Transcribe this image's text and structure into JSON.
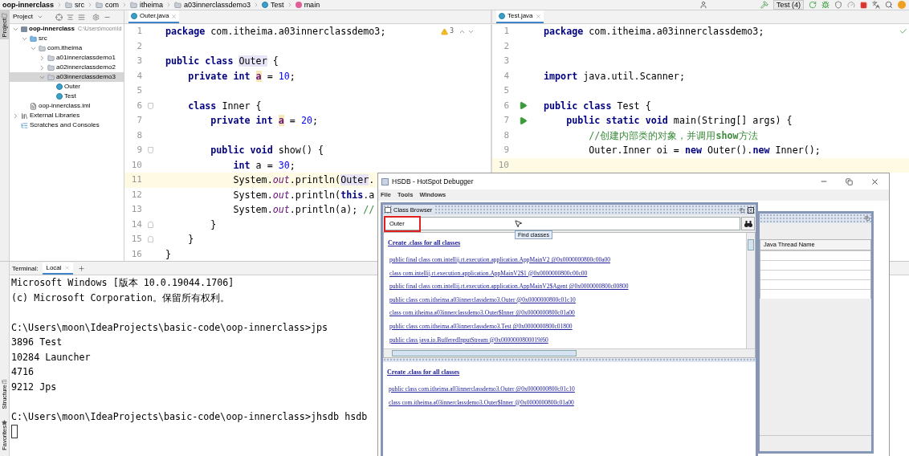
{
  "breadcrumbs": [
    {
      "label": "oop-innerclass",
      "kind": "module"
    },
    {
      "label": "src",
      "kind": "folder"
    },
    {
      "label": "com",
      "kind": "folder"
    },
    {
      "label": "itheima",
      "kind": "folder"
    },
    {
      "label": "a03innerclassdemo3",
      "kind": "folder"
    },
    {
      "label": "Test",
      "kind": "class"
    },
    {
      "label": "main",
      "kind": "method"
    }
  ],
  "toolbar": {
    "run_config": "Test (4)"
  },
  "left_stripe": {
    "tabs": [
      {
        "label": "Project",
        "selected": true
      }
    ],
    "bottom_tabs": [
      {
        "label": "Structure"
      },
      {
        "label": "Favorites"
      }
    ]
  },
  "project_panel": {
    "title": "Project",
    "tree": [
      {
        "label": "oop-innerclass",
        "hint": "C:\\Users\\moon\\Id",
        "kind": "module",
        "expanded": true,
        "selected": false,
        "children": [
          {
            "label": "src",
            "kind": "source",
            "expanded": true,
            "selected": false,
            "children": [
              {
                "label": "com.itheima",
                "kind": "package",
                "expanded": true,
                "selected": false,
                "children": [
                  {
                    "label": "a01innerclassdemo1",
                    "kind": "package",
                    "expanded": false,
                    "selected": false
                  },
                  {
                    "label": "a02innerclassdemo2",
                    "kind": "package",
                    "expanded": false,
                    "selected": false
                  },
                  {
                    "label": "a03innerclassdemo3",
                    "kind": "package",
                    "expanded": true,
                    "selected": true,
                    "children": [
                      {
                        "label": "Outer",
                        "kind": "class",
                        "selected": false
                      },
                      {
                        "label": "Test",
                        "kind": "class",
                        "selected": false
                      }
                    ]
                  }
                ]
              }
            ]
          },
          {
            "label": "oop-innerclass.iml",
            "kind": "file",
            "selected": false
          }
        ]
      },
      {
        "label": "External Libraries",
        "kind": "library",
        "expanded": false,
        "selected": false
      },
      {
        "label": "Scratches and Consoles",
        "kind": "scratches",
        "selected": false
      }
    ]
  },
  "editors": [
    {
      "tab": {
        "label": "Outer.java",
        "selected": true
      },
      "inspection": {
        "kind": "warning",
        "count": "3"
      },
      "lines": [
        {
          "number": "1",
          "current": false,
          "tokens": [
            {
              "kind": "keyword",
              "text": "package"
            },
            {
              "kind": "plain",
              "text": " com.itheima.a03innerclassdemo3;"
            }
          ]
        },
        {
          "number": "2",
          "current": false
        },
        {
          "number": "3",
          "current": false,
          "tokens": [
            {
              "kind": "keyword",
              "text": "public class "
            },
            {
              "kind": "usage",
              "text": "Outer"
            },
            {
              "kind": "plain",
              "text": " {"
            }
          ]
        },
        {
          "number": "4",
          "current": false,
          "tokens": [
            {
              "kind": "keyword",
              "text": "    private int "
            },
            {
              "kind": "field",
              "text": "a"
            },
            {
              "kind": "plain",
              "text": " = "
            },
            {
              "kind": "number",
              "text": "10"
            },
            {
              "kind": "plain",
              "text": ";"
            }
          ]
        },
        {
          "number": "5",
          "current": false
        },
        {
          "number": "6",
          "current": false,
          "gutter": {
            "kind": "fold-start"
          },
          "tokens": [
            {
              "kind": "keyword",
              "text": "    class "
            },
            {
              "kind": "plain",
              "text": "Inner {"
            }
          ]
        },
        {
          "number": "7",
          "current": false,
          "tokens": [
            {
              "kind": "keyword",
              "text": "        private int "
            },
            {
              "kind": "field",
              "text": "a"
            },
            {
              "kind": "plain",
              "text": " = "
            },
            {
              "kind": "number",
              "text": "20"
            },
            {
              "kind": "plain",
              "text": ";"
            }
          ]
        },
        {
          "number": "8",
          "current": false
        },
        {
          "number": "9",
          "current": false,
          "gutter": {
            "kind": "fold-start"
          },
          "tokens": [
            {
              "kind": "keyword",
              "text": "        public void "
            },
            {
              "kind": "plain",
              "text": "show() {"
            }
          ]
        },
        {
          "number": "10",
          "current": false,
          "tokens": [
            {
              "kind": "keyword",
              "text": "            int"
            },
            {
              "kind": "plain",
              "text": " a = "
            },
            {
              "kind": "number",
              "text": "30"
            },
            {
              "kind": "plain",
              "text": ";"
            }
          ]
        },
        {
          "number": "11",
          "current": true,
          "tokens": [
            {
              "kind": "plain",
              "text": "            System."
            },
            {
              "kind": "static",
              "text": "out"
            },
            {
              "kind": "plain",
              "text": ".println("
            },
            {
              "kind": "usage",
              "text": "Outer"
            },
            {
              "kind": "plain",
              "text": "."
            }
          ]
        },
        {
          "number": "12",
          "current": false,
          "tokens": [
            {
              "kind": "plain",
              "text": "            System."
            },
            {
              "kind": "static",
              "text": "out"
            },
            {
              "kind": "plain",
              "text": ".println("
            },
            {
              "kind": "keyword",
              "text": "this"
            },
            {
              "kind": "plain",
              "text": ".a"
            }
          ]
        },
        {
          "number": "13",
          "current": false,
          "tokens": [
            {
              "kind": "plain",
              "text": "            System."
            },
            {
              "kind": "static",
              "text": "out"
            },
            {
              "kind": "plain",
              "text": ".println(a); "
            },
            {
              "kind": "comment",
              "text": "//"
            }
          ]
        },
        {
          "number": "14",
          "current": false,
          "gutter": {
            "kind": "fold-end"
          },
          "tokens": [
            {
              "kind": "plain",
              "text": "        }"
            }
          ]
        },
        {
          "number": "15",
          "current": false,
          "gutter": {
            "kind": "fold-end"
          },
          "tokens": [
            {
              "kind": "plain",
              "text": "    }"
            }
          ]
        },
        {
          "number": "16",
          "current": false,
          "tokens": [
            {
              "kind": "plain",
              "text": "}"
            }
          ]
        }
      ]
    },
    {
      "tab": {
        "label": "Test.java",
        "selected": true
      },
      "inspection": {
        "kind": "ok"
      },
      "lines": [
        {
          "number": "1",
          "current": false,
          "tokens": [
            {
              "kind": "keyword",
              "text": "package"
            },
            {
              "kind": "plain",
              "text": " com.itheima.a03innerclassdemo3;"
            }
          ]
        },
        {
          "number": "2",
          "current": false
        },
        {
          "number": "3",
          "current": false
        },
        {
          "number": "4",
          "current": false,
          "tokens": [
            {
              "kind": "keyword",
              "text": "import "
            },
            {
              "kind": "plain",
              "text": "java.util.Scanner;"
            }
          ]
        },
        {
          "number": "5",
          "current": false
        },
        {
          "number": "6",
          "current": false,
          "gutter": {
            "kind": "run"
          },
          "tokens": [
            {
              "kind": "keyword",
              "text": "public class "
            },
            {
              "kind": "plain",
              "text": "Test {"
            }
          ]
        },
        {
          "number": "7",
          "current": false,
          "gutter": {
            "kind": "run"
          },
          "tokens": [
            {
              "kind": "keyword",
              "text": "    public static void "
            },
            {
              "kind": "plain",
              "text": "main(String[] args) {"
            }
          ]
        },
        {
          "number": "8",
          "current": false,
          "tokens": [
            {
              "kind": "comment",
              "text": "        //创建内部类的对象，并调用"
            },
            {
              "kind": "comment-tag",
              "text": "show"
            },
            {
              "kind": "comment",
              "text": "方法"
            }
          ]
        },
        {
          "number": "9",
          "current": false,
          "tokens": [
            {
              "kind": "plain",
              "text": "        Outer.Inner oi = "
            },
            {
              "kind": "keyword",
              "text": "new "
            },
            {
              "kind": "plain",
              "text": "Outer()."
            },
            {
              "kind": "keyword",
              "text": "new "
            },
            {
              "kind": "plain",
              "text": "Inner();"
            }
          ]
        },
        {
          "number": "10",
          "current": true
        }
      ]
    }
  ],
  "terminal": {
    "label": "Terminal:",
    "tabs": [
      {
        "label": "Local",
        "selected": true
      }
    ],
    "blocks": [
      [
        "Microsoft Windows [版本 10.0.19044.1706]",
        "(c) Microsoft Corporation。保留所有权利。"
      ],
      [
        "C:\\Users\\moon\\IdeaProjects\\basic-code\\oop-innerclass>jps",
        "3896 Test",
        "10284 Launcher",
        "4716",
        "9212 Jps"
      ],
      [
        "C:\\Users\\moon\\IdeaProjects\\basic-code\\oop-innerclass>jhsdb hsdb"
      ]
    ],
    "cursor": true
  },
  "hsdb": {
    "title": "HSDB - HotSpot Debugger",
    "menu": [
      "File",
      "Tools",
      "Windows"
    ],
    "class_browser": {
      "title": "Class Browser",
      "search": {
        "value": "Outer",
        "marked": true
      },
      "tooltip": "Find classes",
      "results": {
        "header": "Create .class for all classes",
        "links": [
          "public final class com.intellij.rt.execution.application.AppMainV2 @0x0000000800c00a00",
          "class com.intellij.rt.execution.application.AppMainV2$1 @0x0000000800c00c00",
          "public final class com.intellij.rt.execution.application.AppMainV2$Agent @0x0000000800c00800",
          "public class com.itheima.a03innerclassdemo3.Outer @0x0000000800c01c10",
          "class com.itheima.a03innerclassdemo3.Outer$Inner @0x0000000800c01a00",
          "public class com.itheima.a03innerclassdemo3.Test @0x0000000800c01800",
          "public class java.io.BufferedInputStream @0x0000000800019f60"
        ]
      },
      "details": {
        "header": "Create .class for all classes",
        "links": [
          "public class com.itheima.a03innerclassdemo3.Outer @0x0000000800c01c10",
          "class com.itheima.a03innerclassdemo3.Outer$Inner @0x0000000800c01a00"
        ]
      }
    },
    "threads": {
      "column": "Java Thread Name"
    }
  }
}
